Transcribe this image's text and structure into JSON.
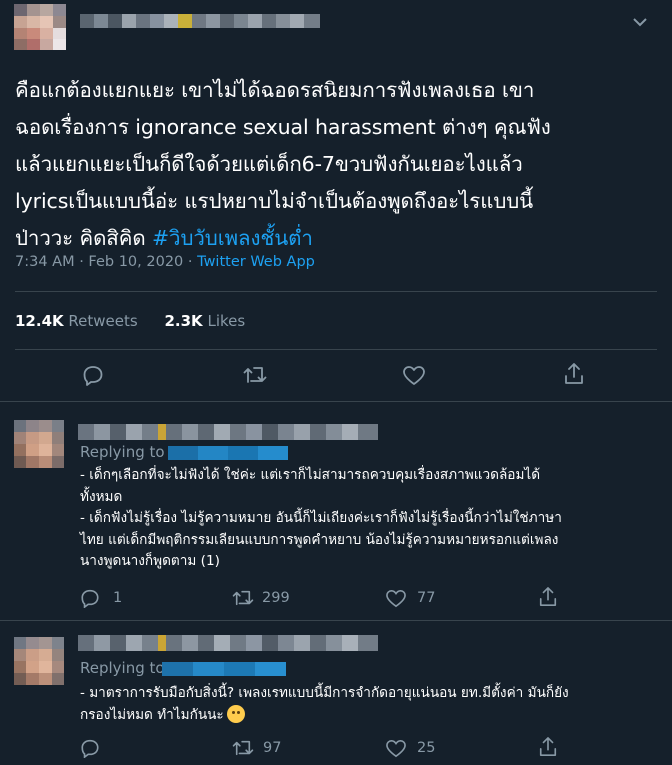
{
  "colors": {
    "background": "#15202b",
    "text": "#ffffff",
    "muted": "#8899a6",
    "accent": "#1da1f2",
    "divider": "#38444d"
  },
  "main_tweet": {
    "body_lines": [
      "คือแกต้องแยกแยะ เขาไม่ได้ฉอดรสนิยมการฟังเพลงเธอ เขา",
      "ฉอดเรื่องการ  ignorance sexual harassment  ต่างๆ คุณฟัง",
      "แล้วแยกแยะเป็นก็ดีใจด้วยแต่เด็ก6-7ขวบฟังกันเยอะไงแล้ว",
      "lyricsเป็นแบบนี้อ่ะ แรปหยาบไม่จำเป็นต้องพูดถึงอะไรแบบนี้",
      "ป่าววะ คิดสิคิด "
    ],
    "hashtag": "#วิบวับเพลงชั้นต่ำ",
    "time": "7:34 AM · Feb 10, 2020 · ",
    "source": "Twitter Web App",
    "retweets_count": "12.4K",
    "retweets_label": " Retweets",
    "likes_count": "2.3K",
    "likes_label": " Likes",
    "icons": [
      "reply-icon",
      "retweet-icon",
      "like-icon",
      "share-icon",
      "chevron-down-icon"
    ]
  },
  "replies": [
    {
      "replying_to": "Replying to",
      "lines": [
        "- เด็กๆเลือกที่จะไม่ฟังได้ ใช่ค่ะ แต่เราก็ไม่สามารถควบคุมเรื่องสภาพแวดล้อมได้",
        "ทั้งหมด",
        "- เด็กฟังไม่รู้เรื่อง ไม่รู้ความหมาย อันนี้ก็ไม่เถียงค่ะเราก็ฟังไม่รู้เรื่องนี้กว่าไม่ใช่ภาษา",
        "ไทย แต่เด็กมีพฤติกรรมเลียนแบบการพูดคำหยาบ น้องไม่รู้ความหมายหรอกแต่เพลง",
        "นางพูดนางก็พูดตาม (1)"
      ],
      "reply_count": "1",
      "retweet_count": "299",
      "like_count": "77"
    },
    {
      "replying_to": "Replying to",
      "lines": [
        "- มาตราการรับมือกับสิ่งนี้? เพลงเรทแบบนี้มีการจำกัดอายุแน่นอน ยท.มีตั้งค่า มันก็ยัง",
        "กรองไม่หมด ทำไมกันนะ"
      ],
      "emoji": "thinking-face-emoji",
      "reply_count": "",
      "retweet_count": "97",
      "like_count": "25"
    }
  ]
}
